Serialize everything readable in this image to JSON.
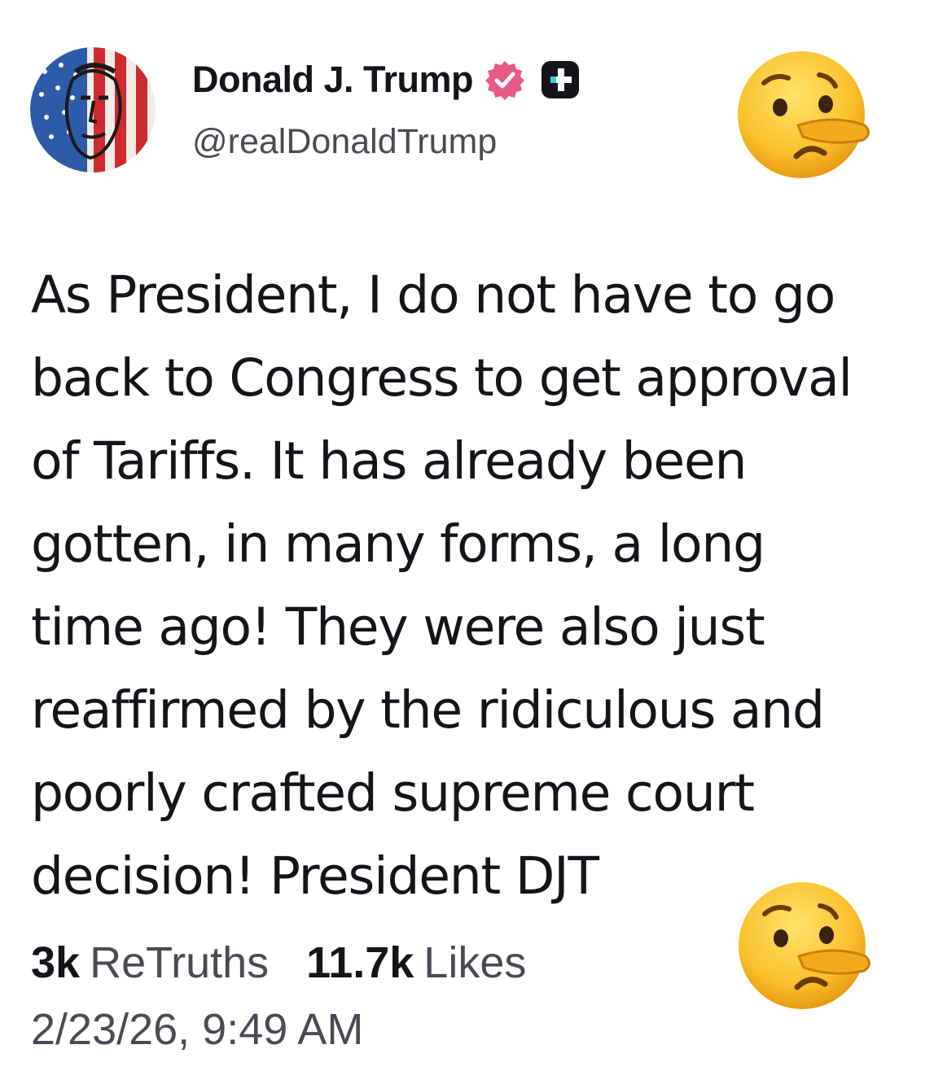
{
  "author": {
    "display_name": "Donald J. Trump",
    "handle": "@realDonaldTrump",
    "verified_badge_icon": "verified-badge-icon",
    "plus_badge_icon": "plus-badge-icon"
  },
  "post": {
    "lines": [
      "As President, I do not have to go",
      "back to Congress to get approval",
      "of Tariffs. It has already been",
      "gotten, in many forms, a long",
      "time ago! They were also just",
      "reaffirmed by the ridiculous and",
      "poorly crafted supreme court",
      "decision! President DJT"
    ]
  },
  "stats": {
    "retruths_count": "3k",
    "retruths_label": "ReTruths",
    "likes_count": "11.7k",
    "likes_label": "Likes"
  },
  "timestamp": "2/23/26, 9:49 AM",
  "decorations": {
    "emoji_top": "lying-face-icon",
    "emoji_bottom": "lying-face-icon"
  },
  "colors": {
    "text": "#15141a",
    "muted": "#4b4a54",
    "verified": "#e85a86",
    "background": "#ffffff"
  }
}
